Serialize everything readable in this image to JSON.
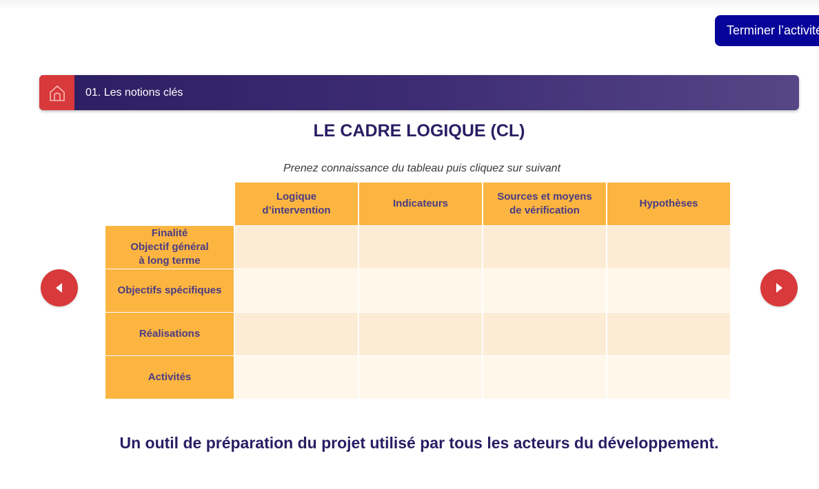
{
  "header": {
    "finish_button": "Terminer l’activité"
  },
  "section": {
    "title": "01. Les notions clés",
    "home_icon": "home-icon"
  },
  "main": {
    "title": "LE CADRE LOGIQUE (CL)",
    "instruction": "Prenez connaissance du tableau puis cliquez sur suivant",
    "conclusion": "Un outil de préparation du projet utilisé par tous les acteurs du développement."
  },
  "table": {
    "columns": [
      "Logique\nd’intervention",
      "Indicateurs",
      "Sources et moyens\nde vérification",
      "Hypothèses"
    ],
    "rows": [
      "Finalité\nObjectif général\nà long terme",
      "Objectifs spécifiques",
      "Réalisations",
      "Activités"
    ]
  },
  "nav": {
    "prev_icon": "triangle-left-icon",
    "next_icon": "triangle-right-icon"
  },
  "colors": {
    "accent_red": "#d8393b",
    "header_orange": "#fbb540",
    "title_purple": "#2a1d63",
    "finish_blue": "#07049a"
  }
}
